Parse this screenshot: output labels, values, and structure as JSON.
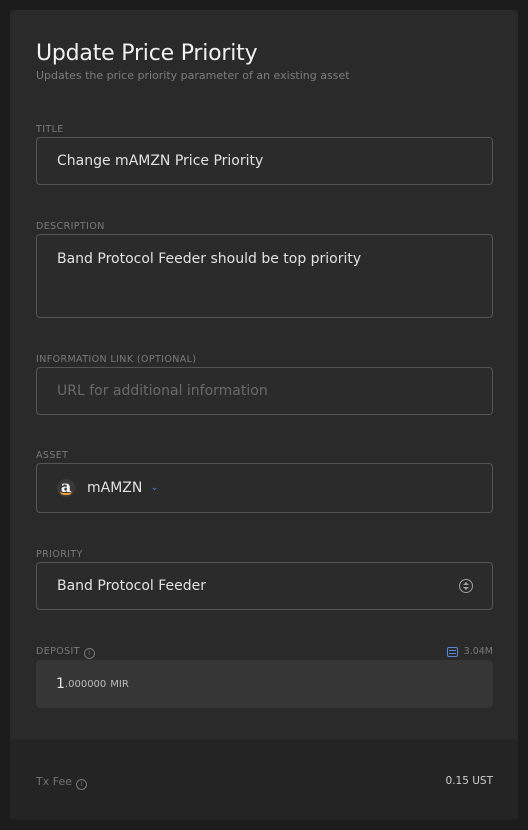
{
  "header": {
    "title": "Update Price Priority",
    "subtitle": "Updates the price priority parameter of an existing asset"
  },
  "fields": {
    "title": {
      "label": "TITLE",
      "value": "Change mAMZN Price Priority"
    },
    "description": {
      "label": "DESCRIPTION",
      "value": "Band Protocol Feeder should be top priority"
    },
    "info_link": {
      "label": "INFORMATION LINK (OPTIONAL)",
      "placeholder": "URL for additional information"
    },
    "asset": {
      "label": "ASSET",
      "value": "mAMZN",
      "icon": "amazon-logo-icon"
    },
    "priority": {
      "label": "PRIORITY",
      "value": "Band Protocol Feeder"
    },
    "deposit": {
      "label": "DEPOSIT",
      "balance": "3.04M",
      "amount_int": "1",
      "amount_dec": ".000000",
      "unit": "MIR"
    }
  },
  "footer": {
    "tx_fee_label": "Tx Fee",
    "tx_fee_value": "0.15 UST"
  },
  "colors": {
    "background": "#1c1c1c",
    "card": "#2a2a2a",
    "accent": "#4d7bd6"
  }
}
